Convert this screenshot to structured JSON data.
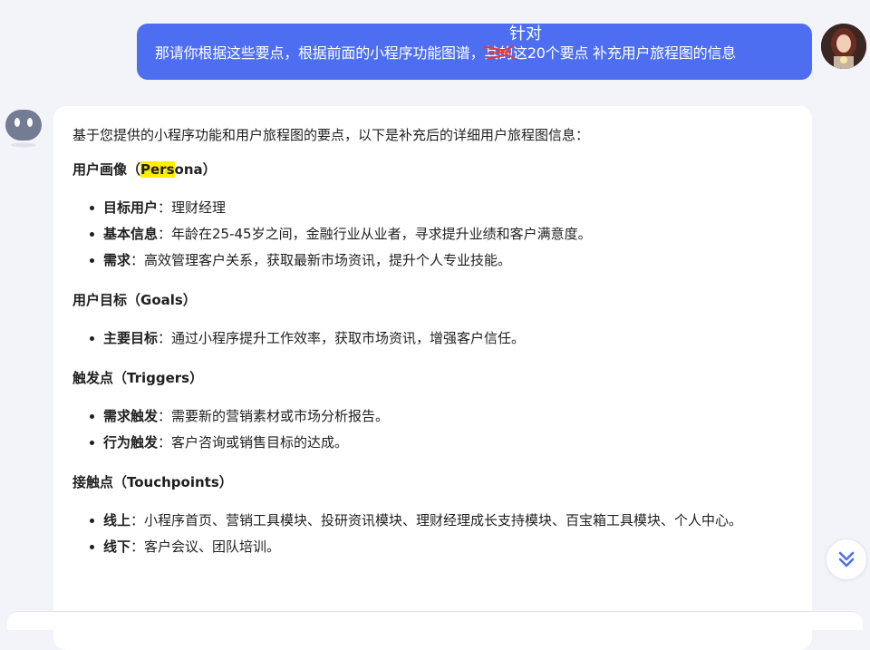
{
  "user_message": {
    "text_before": "那请你根据这些要点，根据前面的小程序功能图谱，",
    "struck_text": "其的",
    "inserted_text": "针对",
    "text_after": "这20个要点 补充用户旅程图的信息",
    "bubble_color": "#4e6ef2"
  },
  "assistant": {
    "intro": "基于您提供的小程序功能和用户旅程图的要点，以下是补充后的详细用户旅程图信息：",
    "sections": [
      {
        "title_pre": "用户画像（",
        "title_hl": "Pers",
        "title_post": "ona）",
        "items": [
          {
            "label": "目标用户",
            "text": "：理财经理"
          },
          {
            "label": "基本信息",
            "text": "：年龄在25-45岁之间，金融行业从业者，寻求提升业绩和客户满意度。"
          },
          {
            "label": "需求",
            "text": "：高效管理客户关系，获取最新市场资讯，提升个人专业技能。"
          }
        ]
      },
      {
        "title": "用户目标（Goals）",
        "items": [
          {
            "label": "主要目标",
            "text": "：通过小程序提升工作效率，获取市场资讯，增强客户信任。"
          }
        ]
      },
      {
        "title": "触发点（Triggers）",
        "items": [
          {
            "label": "需求触发",
            "text": "：需要新的营销素材或市场分析报告。"
          },
          {
            "label": "行为触发",
            "text": "：客户咨询或销售目标的达成。"
          }
        ]
      },
      {
        "title": "接触点（Touchpoints）",
        "items": [
          {
            "label": "线上",
            "text": "：小程序首页、营销工具模块、投研资讯模块、理财经理成长支持模块、百宝箱工具模块、个人中心。"
          },
          {
            "label": "线下",
            "text": "：客户会议、团队培训。"
          }
        ]
      }
    ]
  },
  "icons": {
    "bot_avatar": "bot-face-icon",
    "user_avatar": "user-photo-avatar",
    "scroll_down": "double-chevron-down-icon"
  },
  "colors": {
    "accent": "#4e6ef2",
    "highlight": "#ffee00",
    "background": "#f3f4f9"
  }
}
